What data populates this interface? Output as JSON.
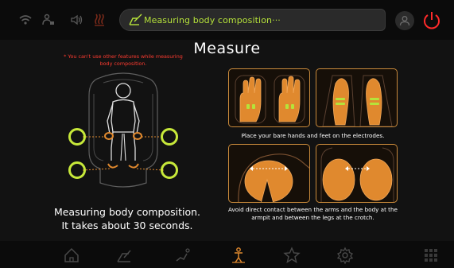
{
  "status_bar": {
    "message": "Measuring body composition···",
    "icons": [
      "wifi-icon",
      "user-lock-icon",
      "volume-icon",
      "heat-icon",
      "pen-icon",
      "user-icon",
      "power-icon"
    ]
  },
  "title": "Measure",
  "warning": "* You can't use other features while measuring body composition.",
  "bottom_text": {
    "line1": "Measuring body composition.",
    "line2": "It takes about 30 seconds."
  },
  "instructions": {
    "step1": "Place your bare hands and feet on the electrodes.",
    "step2": "Avoid direct contact between the arms and the body at the armpit and between the legs at the crotch."
  },
  "nav_bar": {
    "items": [
      "home-icon",
      "massage-icon",
      "stretch-icon",
      "body-measure-icon",
      "favorites-icon",
      "settings-icon",
      "apps-grid-icon"
    ],
    "active": "body-measure-icon"
  },
  "colors": {
    "accent_green": "#b6e23a",
    "accent_orange": "#e0892e",
    "warning_red": "#ff3b30",
    "background": "#121212"
  }
}
